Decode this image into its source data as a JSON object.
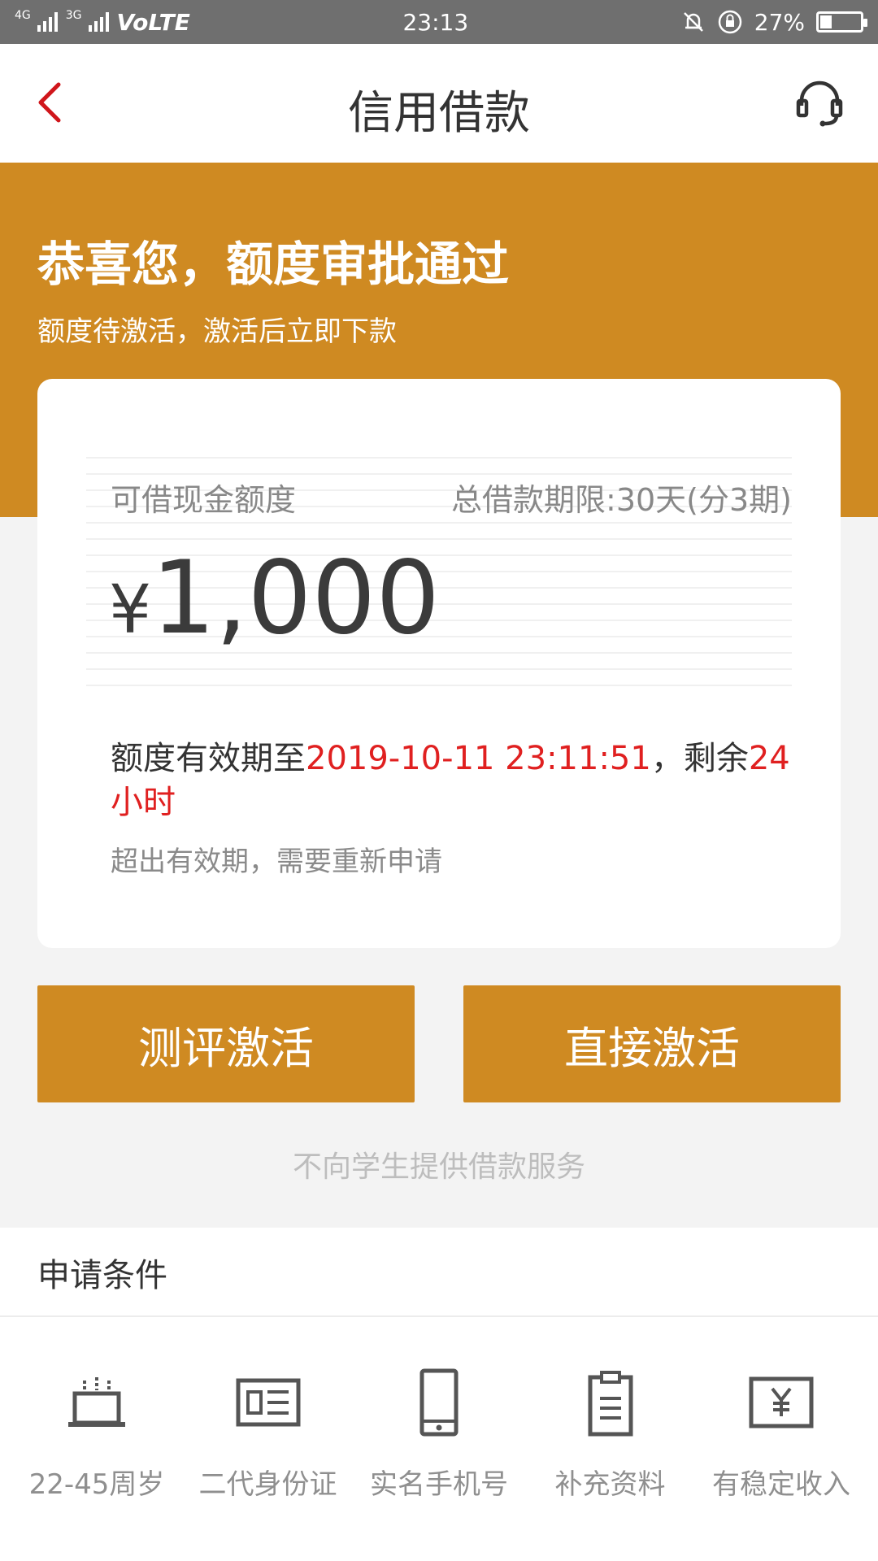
{
  "status_bar": {
    "network_left": "4G",
    "network_right": "3G",
    "volte": "VoLTE",
    "time": "23:13",
    "battery": "27%",
    "battery_level": 0.27
  },
  "header": {
    "title": "信用借款",
    "back_icon": "chevron-left-icon",
    "support_icon": "headset-icon"
  },
  "banner": {
    "title": "恭喜您，额度审批通过",
    "subtitle": "额度待激活，激活后立即下款"
  },
  "card": {
    "credit_label": "可借现金额度",
    "term_label": "总借款期限:30天(分3期)",
    "currency": "¥",
    "amount": "1,000",
    "validity_prefix": "额度有效期至",
    "validity_datetime": "2019-10-11 23:11:51",
    "validity_mid": "，剩余",
    "validity_remaining": "24小时",
    "expire_note": "超出有效期，需要重新申请"
  },
  "buttons": {
    "evaluate": "测评激活",
    "direct": "直接激活"
  },
  "notice": "不向学生提供借款服务",
  "conditions": {
    "title": "申请条件",
    "items": [
      {
        "label": "22-45周岁",
        "icon": "cake-icon"
      },
      {
        "label": "二代身份证",
        "icon": "id-card-icon"
      },
      {
        "label": "实名手机号",
        "icon": "phone-icon"
      },
      {
        "label": "补充资料",
        "icon": "clipboard-icon"
      },
      {
        "label": "有稳定收入",
        "icon": "income-icon"
      }
    ]
  },
  "colors": {
    "accent": "#cf8a22",
    "highlight_red": "#e02020",
    "back_red": "#d0161b"
  }
}
